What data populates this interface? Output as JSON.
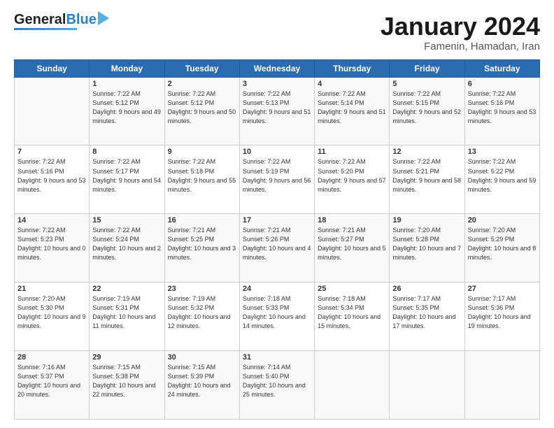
{
  "header": {
    "logo_line1": "General",
    "logo_line2": "Blue",
    "month_title": "January 2024",
    "subtitle": "Famenin, Hamadan, Iran"
  },
  "weekdays": [
    "Sunday",
    "Monday",
    "Tuesday",
    "Wednesday",
    "Thursday",
    "Friday",
    "Saturday"
  ],
  "weeks": [
    [
      {
        "day": "",
        "sunrise": "",
        "sunset": "",
        "daylight": ""
      },
      {
        "day": "1",
        "sunrise": "Sunrise: 7:22 AM",
        "sunset": "Sunset: 5:12 PM",
        "daylight": "Daylight: 9 hours and 49 minutes."
      },
      {
        "day": "2",
        "sunrise": "Sunrise: 7:22 AM",
        "sunset": "Sunset: 5:12 PM",
        "daylight": "Daylight: 9 hours and 50 minutes."
      },
      {
        "day": "3",
        "sunrise": "Sunrise: 7:22 AM",
        "sunset": "Sunset: 5:13 PM",
        "daylight": "Daylight: 9 hours and 51 minutes."
      },
      {
        "day": "4",
        "sunrise": "Sunrise: 7:22 AM",
        "sunset": "Sunset: 5:14 PM",
        "daylight": "Daylight: 9 hours and 51 minutes."
      },
      {
        "day": "5",
        "sunrise": "Sunrise: 7:22 AM",
        "sunset": "Sunset: 5:15 PM",
        "daylight": "Daylight: 9 hours and 52 minutes."
      },
      {
        "day": "6",
        "sunrise": "Sunrise: 7:22 AM",
        "sunset": "Sunset: 5:16 PM",
        "daylight": "Daylight: 9 hours and 53 minutes."
      }
    ],
    [
      {
        "day": "7",
        "sunrise": "Sunrise: 7:22 AM",
        "sunset": "Sunset: 5:16 PM",
        "daylight": "Daylight: 9 hours and 53 minutes."
      },
      {
        "day": "8",
        "sunrise": "Sunrise: 7:22 AM",
        "sunset": "Sunset: 5:17 PM",
        "daylight": "Daylight: 9 hours and 54 minutes."
      },
      {
        "day": "9",
        "sunrise": "Sunrise: 7:22 AM",
        "sunset": "Sunset: 5:18 PM",
        "daylight": "Daylight: 9 hours and 55 minutes."
      },
      {
        "day": "10",
        "sunrise": "Sunrise: 7:22 AM",
        "sunset": "Sunset: 5:19 PM",
        "daylight": "Daylight: 9 hours and 56 minutes."
      },
      {
        "day": "11",
        "sunrise": "Sunrise: 7:22 AM",
        "sunset": "Sunset: 5:20 PM",
        "daylight": "Daylight: 9 hours and 57 minutes."
      },
      {
        "day": "12",
        "sunrise": "Sunrise: 7:22 AM",
        "sunset": "Sunset: 5:21 PM",
        "daylight": "Daylight: 9 hours and 58 minutes."
      },
      {
        "day": "13",
        "sunrise": "Sunrise: 7:22 AM",
        "sunset": "Sunset: 5:22 PM",
        "daylight": "Daylight: 9 hours and 59 minutes."
      }
    ],
    [
      {
        "day": "14",
        "sunrise": "Sunrise: 7:22 AM",
        "sunset": "Sunset: 5:23 PM",
        "daylight": "Daylight: 10 hours and 0 minutes."
      },
      {
        "day": "15",
        "sunrise": "Sunrise: 7:22 AM",
        "sunset": "Sunset: 5:24 PM",
        "daylight": "Daylight: 10 hours and 2 minutes."
      },
      {
        "day": "16",
        "sunrise": "Sunrise: 7:21 AM",
        "sunset": "Sunset: 5:25 PM",
        "daylight": "Daylight: 10 hours and 3 minutes."
      },
      {
        "day": "17",
        "sunrise": "Sunrise: 7:21 AM",
        "sunset": "Sunset: 5:26 PM",
        "daylight": "Daylight: 10 hours and 4 minutes."
      },
      {
        "day": "18",
        "sunrise": "Sunrise: 7:21 AM",
        "sunset": "Sunset: 5:27 PM",
        "daylight": "Daylight: 10 hours and 5 minutes."
      },
      {
        "day": "19",
        "sunrise": "Sunrise: 7:20 AM",
        "sunset": "Sunset: 5:28 PM",
        "daylight": "Daylight: 10 hours and 7 minutes."
      },
      {
        "day": "20",
        "sunrise": "Sunrise: 7:20 AM",
        "sunset": "Sunset: 5:29 PM",
        "daylight": "Daylight: 10 hours and 8 minutes."
      }
    ],
    [
      {
        "day": "21",
        "sunrise": "Sunrise: 7:20 AM",
        "sunset": "Sunset: 5:30 PM",
        "daylight": "Daylight: 10 hours and 9 minutes."
      },
      {
        "day": "22",
        "sunrise": "Sunrise: 7:19 AM",
        "sunset": "Sunset: 5:31 PM",
        "daylight": "Daylight: 10 hours and 11 minutes."
      },
      {
        "day": "23",
        "sunrise": "Sunrise: 7:19 AM",
        "sunset": "Sunset: 5:32 PM",
        "daylight": "Daylight: 10 hours and 12 minutes."
      },
      {
        "day": "24",
        "sunrise": "Sunrise: 7:18 AM",
        "sunset": "Sunset: 5:33 PM",
        "daylight": "Daylight: 10 hours and 14 minutes."
      },
      {
        "day": "25",
        "sunrise": "Sunrise: 7:18 AM",
        "sunset": "Sunset: 5:34 PM",
        "daylight": "Daylight: 10 hours and 15 minutes."
      },
      {
        "day": "26",
        "sunrise": "Sunrise: 7:17 AM",
        "sunset": "Sunset: 5:35 PM",
        "daylight": "Daylight: 10 hours and 17 minutes."
      },
      {
        "day": "27",
        "sunrise": "Sunrise: 7:17 AM",
        "sunset": "Sunset: 5:36 PM",
        "daylight": "Daylight: 10 hours and 19 minutes."
      }
    ],
    [
      {
        "day": "28",
        "sunrise": "Sunrise: 7:16 AM",
        "sunset": "Sunset: 5:37 PM",
        "daylight": "Daylight: 10 hours and 20 minutes."
      },
      {
        "day": "29",
        "sunrise": "Sunrise: 7:15 AM",
        "sunset": "Sunset: 5:38 PM",
        "daylight": "Daylight: 10 hours and 22 minutes."
      },
      {
        "day": "30",
        "sunrise": "Sunrise: 7:15 AM",
        "sunset": "Sunset: 5:39 PM",
        "daylight": "Daylight: 10 hours and 24 minutes."
      },
      {
        "day": "31",
        "sunrise": "Sunrise: 7:14 AM",
        "sunset": "Sunset: 5:40 PM",
        "daylight": "Daylight: 10 hours and 25 minutes."
      },
      {
        "day": "",
        "sunrise": "",
        "sunset": "",
        "daylight": ""
      },
      {
        "day": "",
        "sunrise": "",
        "sunset": "",
        "daylight": ""
      },
      {
        "day": "",
        "sunrise": "",
        "sunset": "",
        "daylight": ""
      }
    ]
  ]
}
